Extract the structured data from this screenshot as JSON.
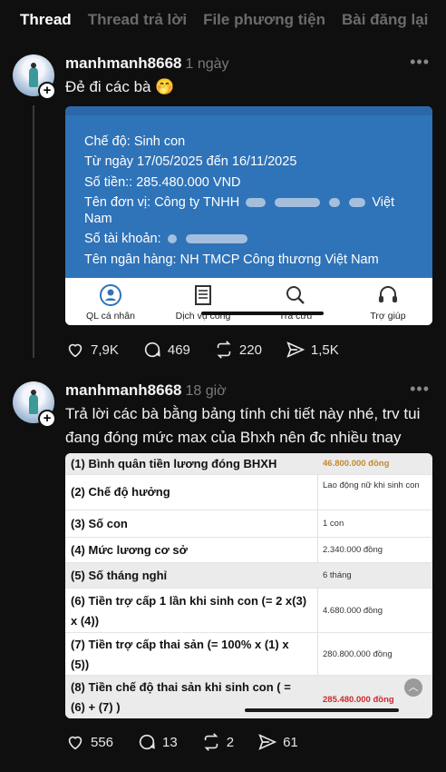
{
  "tabs": [
    "Thread",
    "Thread trả lời",
    "File phương tiện",
    "Bài đăng lại"
  ],
  "posts": [
    {
      "username": "manhmanh8668",
      "time": "1 ngày",
      "text": "Đẻ đi các bà 🤭",
      "counts": {
        "likes": "7,9K",
        "comments": "469",
        "reposts": "220",
        "shares": "1,5K"
      }
    },
    {
      "username": "manhmanh8668",
      "time": "18 giờ",
      "text": "Trả lời các bà bằng bảng tính chi tiết này nhé, trv tui đang đóng mức max của Bhxh nên đc nhiều tnay",
      "counts": {
        "likes": "556",
        "comments": "13",
        "reposts": "2",
        "shares": "61"
      }
    }
  ],
  "image1": {
    "lines": {
      "che_do": "Chế độ: Sinh con",
      "tu_ngay": "Từ ngày 17/05/2025 đến 16/11/2025",
      "so_tien": "Số tiền:: 285.480.000 VND",
      "don_vi_a": "Tên đơn vị: Công ty TNHH",
      "don_vi_b": "Việt",
      "don_vi_c": "Nam",
      "tai_khoan": "Số tài khoản:",
      "ngan_hang": "Tên ngân hàng: NH TMCP Công thương Việt Nam"
    },
    "nav": [
      "QL cá nhân",
      "Dịch vụ công",
      "Tra cứu",
      "Trợ giúp"
    ]
  },
  "table": {
    "rows": [
      {
        "label": "(1) Bình quân tiền lương đóng BHXH",
        "value": "46.800.000 đồng"
      },
      {
        "label": "(2) Chế độ hưởng",
        "value": "Lao động nữ khi sinh con"
      },
      {
        "label": "(3) Số con",
        "value": "1 con"
      },
      {
        "label": "(4) Mức lương cơ sở",
        "value": "2.340.000 đồng"
      },
      {
        "label": "(5) Số tháng nghỉ",
        "value": "6 tháng"
      },
      {
        "label": "(6) Tiền trợ cấp 1 lần khi sinh con (= 2 x(3) x (4))",
        "value": "4.680.000 đồng"
      },
      {
        "label": "(7) Tiền trợ cấp thai sản (= 100% x (1) x (5))",
        "value": "280.800.000 đồng"
      },
      {
        "label": "(8) Tiền chế độ thai sản khi sinh con ( = (6) + (7) )",
        "value": "285.480.000 đồng"
      }
    ]
  },
  "colors": {
    "bg": "#0f0f0f",
    "card_blue": "#2f73b9",
    "highlight_orange": "#c58a2a",
    "highlight_red": "#d0292c"
  },
  "icons": [
    "more-icon",
    "heart-icon",
    "comment-icon",
    "repost-icon",
    "share-icon",
    "person-icon",
    "document-icon",
    "search-icon",
    "headset-icon",
    "chevron-up-icon"
  ]
}
